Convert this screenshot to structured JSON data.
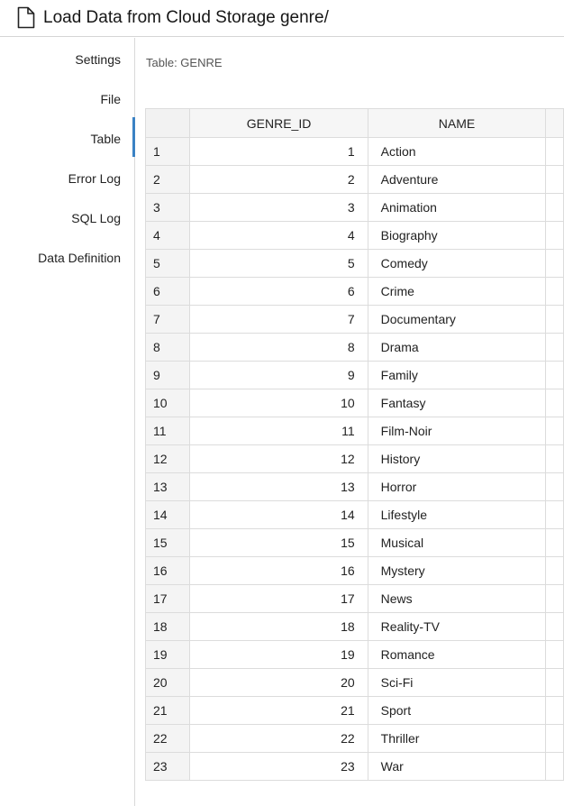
{
  "header": {
    "title": "Load Data from Cloud Storage genre/",
    "icon": "document-icon"
  },
  "sidebar": {
    "items": [
      {
        "label": "Settings"
      },
      {
        "label": "File"
      },
      {
        "label": "Table",
        "active": true
      },
      {
        "label": "Error Log"
      },
      {
        "label": "SQL Log"
      },
      {
        "label": "Data Definition"
      }
    ],
    "accent_color": "#3b82c4"
  },
  "main": {
    "caption": "Table: GENRE",
    "columns": [
      "GENRE_ID",
      "NAME"
    ],
    "rows": [
      {
        "n": "1",
        "id": "1",
        "name": "Action"
      },
      {
        "n": "2",
        "id": "2",
        "name": "Adventure"
      },
      {
        "n": "3",
        "id": "3",
        "name": "Animation"
      },
      {
        "n": "4",
        "id": "4",
        "name": "Biography"
      },
      {
        "n": "5",
        "id": "5",
        "name": "Comedy"
      },
      {
        "n": "6",
        "id": "6",
        "name": "Crime"
      },
      {
        "n": "7",
        "id": "7",
        "name": "Documentary"
      },
      {
        "n": "8",
        "id": "8",
        "name": "Drama"
      },
      {
        "n": "9",
        "id": "9",
        "name": "Family"
      },
      {
        "n": "10",
        "id": "10",
        "name": "Fantasy"
      },
      {
        "n": "11",
        "id": "11",
        "name": "Film-Noir"
      },
      {
        "n": "12",
        "id": "12",
        "name": "History"
      },
      {
        "n": "13",
        "id": "13",
        "name": "Horror"
      },
      {
        "n": "14",
        "id": "14",
        "name": "Lifestyle"
      },
      {
        "n": "15",
        "id": "15",
        "name": "Musical"
      },
      {
        "n": "16",
        "id": "16",
        "name": "Mystery"
      },
      {
        "n": "17",
        "id": "17",
        "name": "News"
      },
      {
        "n": "18",
        "id": "18",
        "name": "Reality-TV"
      },
      {
        "n": "19",
        "id": "19",
        "name": "Romance"
      },
      {
        "n": "20",
        "id": "20",
        "name": "Sci-Fi"
      },
      {
        "n": "21",
        "id": "21",
        "name": "Sport"
      },
      {
        "n": "22",
        "id": "22",
        "name": "Thriller"
      },
      {
        "n": "23",
        "id": "23",
        "name": "War"
      }
    ]
  }
}
